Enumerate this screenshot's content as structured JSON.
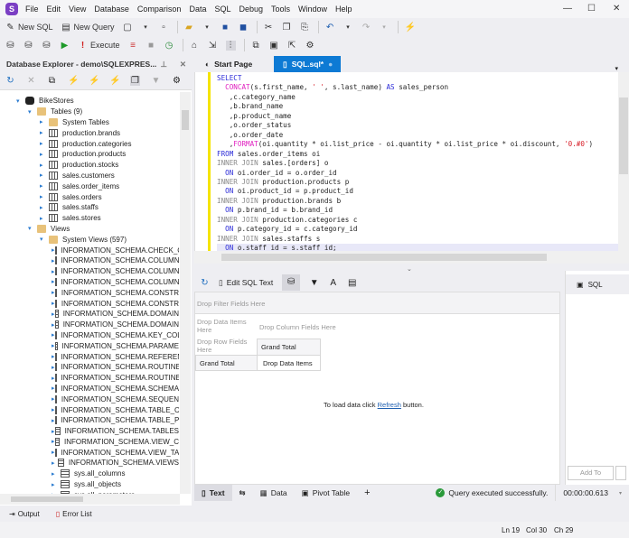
{
  "menu": [
    "File",
    "Edit",
    "View",
    "Database",
    "Comparison",
    "Data",
    "SQL",
    "Debug",
    "Tools",
    "Window",
    "Help"
  ],
  "toolbar": {
    "new_sql": "New SQL",
    "new_query": "New Query",
    "execute": "Execute"
  },
  "explorer": {
    "title": "Database Explorer - demo\\SQLEXPRES...",
    "tree": [
      {
        "level": 0,
        "icon": "db",
        "label": "BikeStores",
        "open": true
      },
      {
        "level": 1,
        "icon": "fold",
        "label": "Tables (9)",
        "open": true
      },
      {
        "level": 2,
        "icon": "fold",
        "label": "System Tables"
      },
      {
        "level": 2,
        "icon": "tbl",
        "label": "production.brands"
      },
      {
        "level": 2,
        "icon": "tbl",
        "label": "production.categories"
      },
      {
        "level": 2,
        "icon": "tbl",
        "label": "production.products"
      },
      {
        "level": 2,
        "icon": "tbl",
        "label": "production.stocks"
      },
      {
        "level": 2,
        "icon": "tbl",
        "label": "sales.customers"
      },
      {
        "level": 2,
        "icon": "tbl",
        "label": "sales.order_items"
      },
      {
        "level": 2,
        "icon": "tbl",
        "label": "sales.orders"
      },
      {
        "level": 2,
        "icon": "tbl",
        "label": "sales.staffs"
      },
      {
        "level": 2,
        "icon": "tbl",
        "label": "sales.stores"
      },
      {
        "level": 1,
        "icon": "fold",
        "label": "Views",
        "open": true
      },
      {
        "level": 2,
        "icon": "fold",
        "label": "System Views (597)",
        "open": true
      },
      {
        "level": 3,
        "icon": "view",
        "label": "INFORMATION_SCHEMA.CHECK_C"
      },
      {
        "level": 3,
        "icon": "view",
        "label": "INFORMATION_SCHEMA.COLUMN"
      },
      {
        "level": 3,
        "icon": "view",
        "label": "INFORMATION_SCHEMA.COLUMN"
      },
      {
        "level": 3,
        "icon": "view",
        "label": "INFORMATION_SCHEMA.COLUMN"
      },
      {
        "level": 3,
        "icon": "view",
        "label": "INFORMATION_SCHEMA.CONSTR"
      },
      {
        "level": 3,
        "icon": "view",
        "label": "INFORMATION_SCHEMA.CONSTR"
      },
      {
        "level": 3,
        "icon": "view",
        "label": "INFORMATION_SCHEMA.DOMAIN"
      },
      {
        "level": 3,
        "icon": "view",
        "label": "INFORMATION_SCHEMA.DOMAIN"
      },
      {
        "level": 3,
        "icon": "view",
        "label": "INFORMATION_SCHEMA.KEY_COL"
      },
      {
        "level": 3,
        "icon": "view",
        "label": "INFORMATION_SCHEMA.PARAME"
      },
      {
        "level": 3,
        "icon": "view",
        "label": "INFORMATION_SCHEMA.REFEREN"
      },
      {
        "level": 3,
        "icon": "view",
        "label": "INFORMATION_SCHEMA.ROUTINE"
      },
      {
        "level": 3,
        "icon": "view",
        "label": "INFORMATION_SCHEMA.ROUTINE"
      },
      {
        "level": 3,
        "icon": "view",
        "label": "INFORMATION_SCHEMA.SCHEMA"
      },
      {
        "level": 3,
        "icon": "view",
        "label": "INFORMATION_SCHEMA.SEQUEN"
      },
      {
        "level": 3,
        "icon": "view",
        "label": "INFORMATION_SCHEMA.TABLE_C"
      },
      {
        "level": 3,
        "icon": "view",
        "label": "INFORMATION_SCHEMA.TABLE_P"
      },
      {
        "level": 3,
        "icon": "view",
        "label": "INFORMATION_SCHEMA.TABLES"
      },
      {
        "level": 3,
        "icon": "view",
        "label": "INFORMATION_SCHEMA.VIEW_C"
      },
      {
        "level": 3,
        "icon": "view",
        "label": "INFORMATION_SCHEMA.VIEW_TA"
      },
      {
        "level": 3,
        "icon": "view",
        "label": "INFORMATION_SCHEMA.VIEWS"
      },
      {
        "level": 3,
        "icon": "view",
        "label": "sys.all_columns"
      },
      {
        "level": 3,
        "icon": "view",
        "label": "sys.all_objects"
      },
      {
        "level": 3,
        "icon": "view",
        "label": "sys.all_parameters"
      }
    ]
  },
  "tabs": {
    "start": "Start Page",
    "sql": "SQL.sql*"
  },
  "code": [
    [
      [
        "kw",
        "SELECT"
      ]
    ],
    [
      [
        "tx",
        "  "
      ],
      [
        "fn",
        "CONCAT"
      ],
      [
        "tx",
        "(s.first_name, "
      ],
      [
        "st",
        "' '"
      ],
      [
        "tx",
        ", s.last_name) "
      ],
      [
        "kw",
        "AS"
      ],
      [
        "tx",
        " sales_person"
      ]
    ],
    [
      [
        "tx",
        "   ,c.category_name"
      ]
    ],
    [
      [
        "tx",
        "   ,b.brand_name"
      ]
    ],
    [
      [
        "tx",
        "   ,p.product_name"
      ]
    ],
    [
      [
        "tx",
        "   ,o.order_status"
      ]
    ],
    [
      [
        "tx",
        "   ,o.order_date"
      ]
    ],
    [
      [
        "tx",
        "   ,"
      ],
      [
        "fn",
        "FORMAT"
      ],
      [
        "tx",
        "(oi.quantity * oi.list_price - oi.quantity * oi.list_price * oi.discount, "
      ],
      [
        "st",
        "'0.#0'"
      ],
      [
        "tx",
        ")"
      ]
    ],
    [
      [
        "kw",
        "FROM"
      ],
      [
        "tx",
        " sales.order_items oi"
      ]
    ],
    [
      [
        "gy",
        "INNER JOIN"
      ],
      [
        "tx",
        " sales.[orders] o"
      ]
    ],
    [
      [
        "tx",
        "  "
      ],
      [
        "kw",
        "ON"
      ],
      [
        "tx",
        " oi.order_id = o.order_id"
      ]
    ],
    [
      [
        "gy",
        "INNER JOIN"
      ],
      [
        "tx",
        " production.products p"
      ]
    ],
    [
      [
        "tx",
        "  "
      ],
      [
        "kw",
        "ON"
      ],
      [
        "tx",
        " oi.product_id = p.product_id"
      ]
    ],
    [
      [
        "gy",
        "INNER JOIN"
      ],
      [
        "tx",
        " production.brands b"
      ]
    ],
    [
      [
        "tx",
        "  "
      ],
      [
        "kw",
        "ON"
      ],
      [
        "tx",
        " p.brand_id = b.brand_id"
      ]
    ],
    [
      [
        "gy",
        "INNER JOIN"
      ],
      [
        "tx",
        " production.categories c"
      ]
    ],
    [
      [
        "tx",
        "  "
      ],
      [
        "kw",
        "ON"
      ],
      [
        "tx",
        " p.category_id = c.category_id"
      ]
    ],
    [
      [
        "gy",
        "INNER JOIN"
      ],
      [
        "tx",
        " sales.staffs s"
      ]
    ],
    [
      [
        "tx",
        "  "
      ],
      [
        "kw",
        "ON"
      ],
      [
        "tx",
        " o.staff_id = s.staff_id;"
      ]
    ]
  ],
  "results": {
    "edit_sql": "Edit SQL Text",
    "drop_filter": "Drop Filter Fields Here",
    "drop_data": "Drop Data Items Here",
    "drop_column": "Drop Column Fields Here",
    "drop_row": "Drop Row Fields Here",
    "grand_total_col": "Grand Total",
    "grand_total_row": "Grand Total",
    "drop_data_cell": "Drop Data Items",
    "load_prefix": "To load data click ",
    "load_link": "Refresh",
    "load_suffix": " button."
  },
  "right_panel": {
    "item": "SQL",
    "add_to": "Add To"
  },
  "bottom_tabs": {
    "text": "Text",
    "data": "Data",
    "pivot": "Pivot Table",
    "status": "Query executed successfully.",
    "time": "00:00:00.613"
  },
  "output_bar": {
    "output": "Output",
    "errors": "Error List"
  },
  "status": {
    "ln": "Ln 19",
    "col": "Col 30",
    "ch": "Ch 29"
  }
}
